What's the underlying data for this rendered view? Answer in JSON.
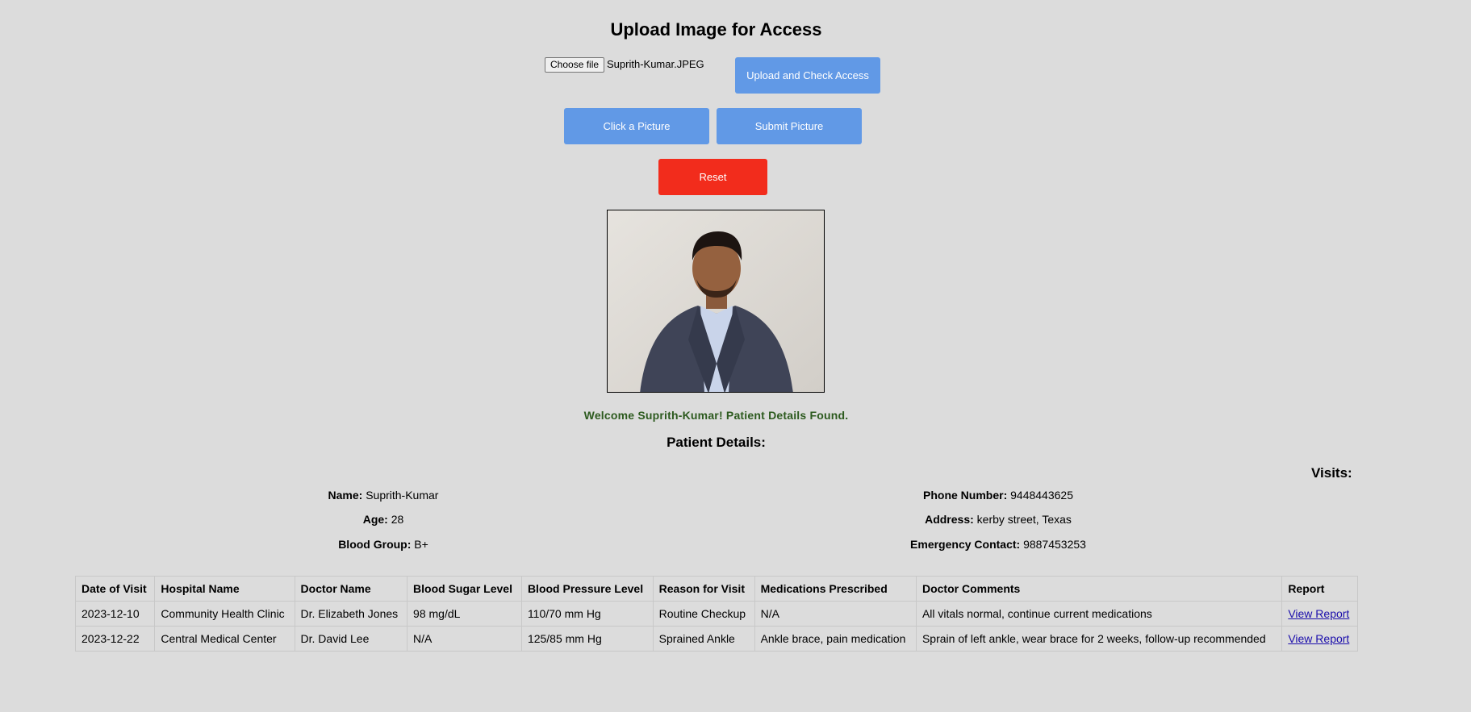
{
  "page": {
    "title": "Upload Image for Access"
  },
  "upload": {
    "choose_label": "Choose file",
    "file_name": "Suprith-Kumar.JPEG",
    "upload_button": "Upload and Check Access"
  },
  "camera": {
    "click_button": "Click a Picture",
    "submit_button": "Submit Picture",
    "reset_button": "Reset"
  },
  "result": {
    "welcome": "Welcome Suprith-Kumar! Patient Details Found.",
    "patient_heading": "Patient Details:",
    "visits_heading": "Visits:"
  },
  "patient": {
    "name_label": "Name:",
    "name": "Suprith-Kumar",
    "age_label": "Age:",
    "age": "28",
    "blood_label": "Blood Group:",
    "blood": "B+",
    "phone_label": "Phone Number:",
    "phone": "9448443625",
    "address_label": "Address:",
    "address": "kerby street, Texas",
    "emergency_label": "Emergency Contact:",
    "emergency": "9887453253"
  },
  "visits_table": {
    "headers": [
      "Date of Visit",
      "Hospital Name",
      "Doctor Name",
      "Blood Sugar Level",
      "Blood Pressure Level",
      "Reason for Visit",
      "Medications Prescribed",
      "Doctor Comments",
      "Report"
    ],
    "rows": [
      [
        "2023-12-10",
        "Community Health Clinic",
        "Dr. Elizabeth Jones",
        "98 mg/dL",
        "110/70 mm Hg",
        "Routine Checkup",
        "N/A",
        "All vitals normal, continue current medications",
        "View Report"
      ],
      [
        "2023-12-22",
        "Central Medical Center",
        "Dr. David Lee",
        "N/A",
        "125/85 mm Hg",
        "Sprained Ankle",
        "Ankle brace, pain medication",
        "Sprain of left ankle, wear brace for 2 weeks, follow-up recommended",
        "View Report"
      ]
    ]
  },
  "colors": {
    "background": "#dcdcdc",
    "button_blue": "#6199e6",
    "button_red": "#f22c1c",
    "welcome_green": "#2c5a1e",
    "link": "#1a0dab"
  }
}
